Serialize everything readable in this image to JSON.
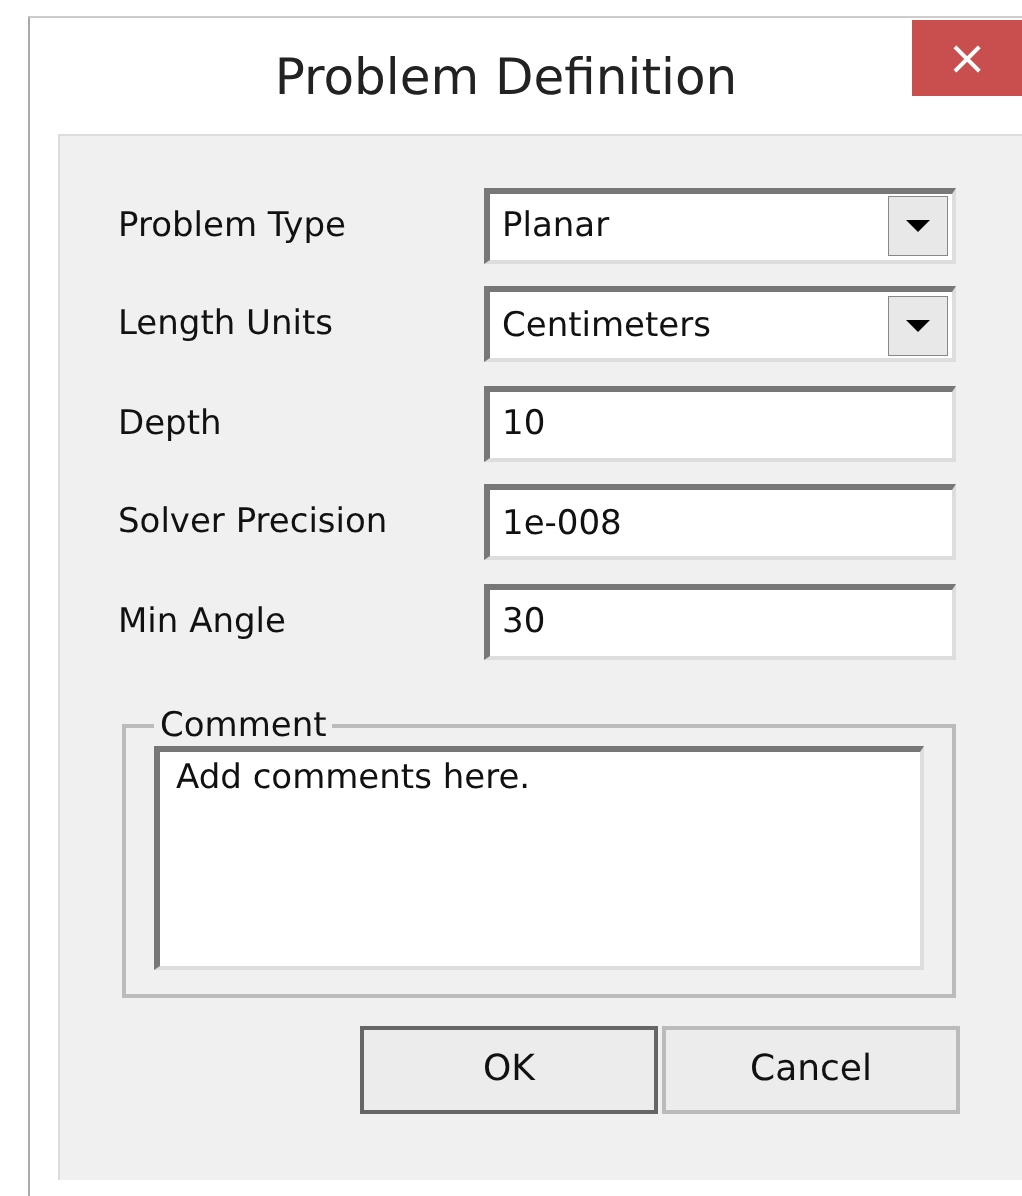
{
  "window": {
    "title": "Problem Definition",
    "close": "×"
  },
  "fields": [
    {
      "label": "Problem Type",
      "kind": "dropdown",
      "value": "Planar"
    },
    {
      "label": "Length Units",
      "kind": "dropdown",
      "value": "Centimeters"
    },
    {
      "label": "Depth",
      "kind": "text",
      "value": "10"
    },
    {
      "label": "Solver Precision",
      "kind": "text",
      "value": "1e-008"
    },
    {
      "label": "Min Angle",
      "kind": "text",
      "value": "30"
    }
  ],
  "comment": {
    "legend": "Comment",
    "value": "Add comments here."
  },
  "buttons": [
    {
      "label": "OK",
      "default": true
    },
    {
      "label": "Cancel",
      "default": false
    }
  ]
}
